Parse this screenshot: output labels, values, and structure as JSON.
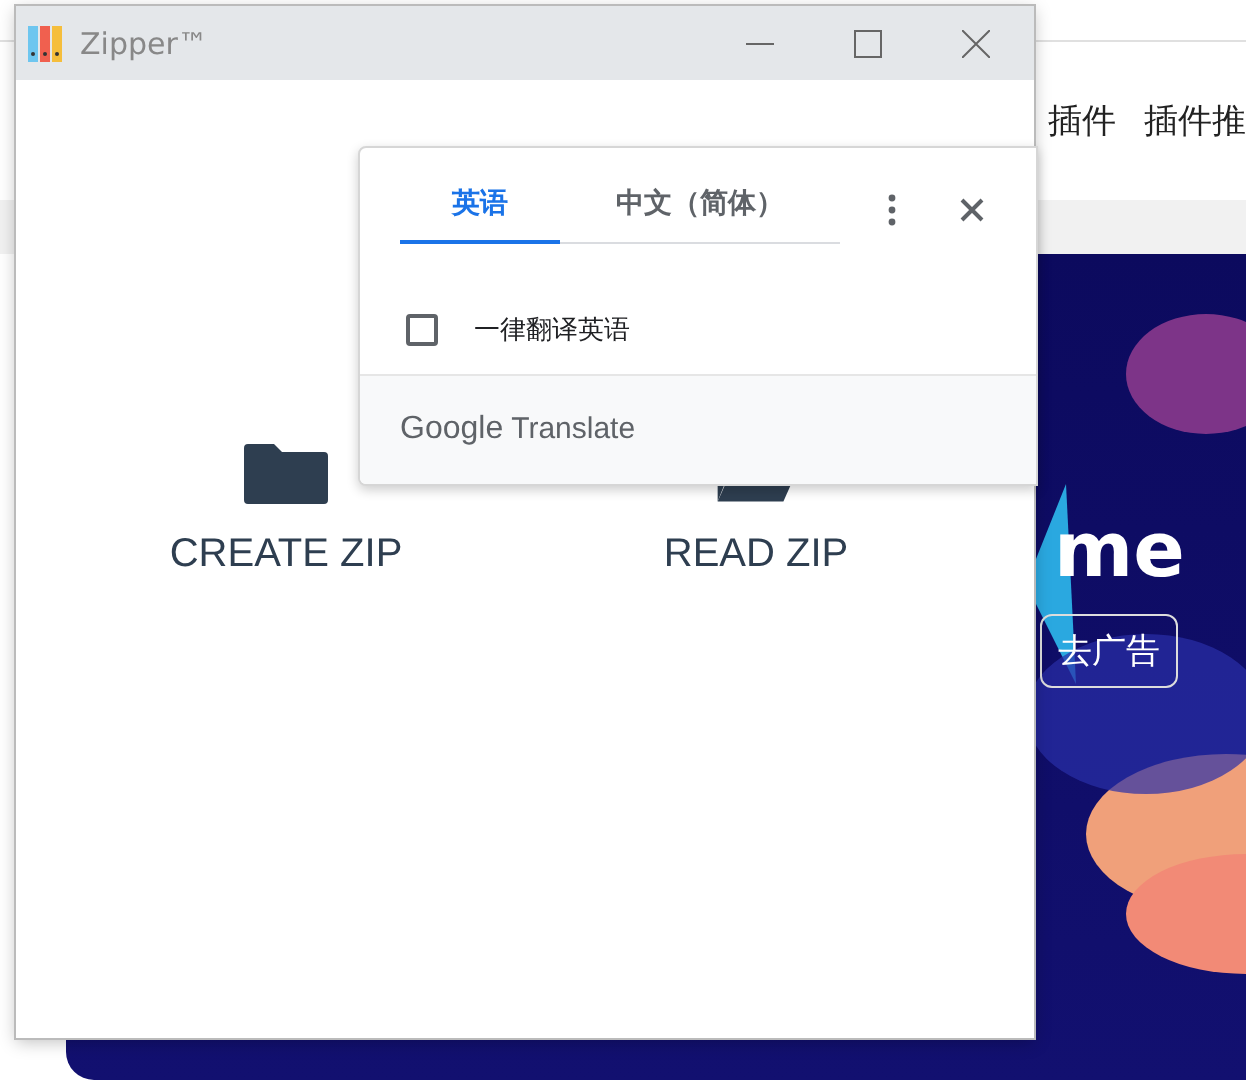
{
  "background_page": {
    "nav_links": [
      "插件",
      "插件推"
    ],
    "banner": {
      "kind": "picture",
      "headline": "me",
      "button": "去广告"
    }
  },
  "window": {
    "title": "Zipper™",
    "actions": [
      {
        "kind": "create",
        "label": "CREATE ZIP"
      },
      {
        "kind": "read",
        "label": "READ ZIP"
      }
    ]
  },
  "translate_popup": {
    "tabs": [
      {
        "label": "英语",
        "selected": true
      },
      {
        "label": "中文（简体）",
        "selected": false
      }
    ],
    "option": {
      "label": "一律翻译英语",
      "checked": false
    },
    "footer": {
      "brand": "Google",
      "product": "Translate"
    }
  }
}
